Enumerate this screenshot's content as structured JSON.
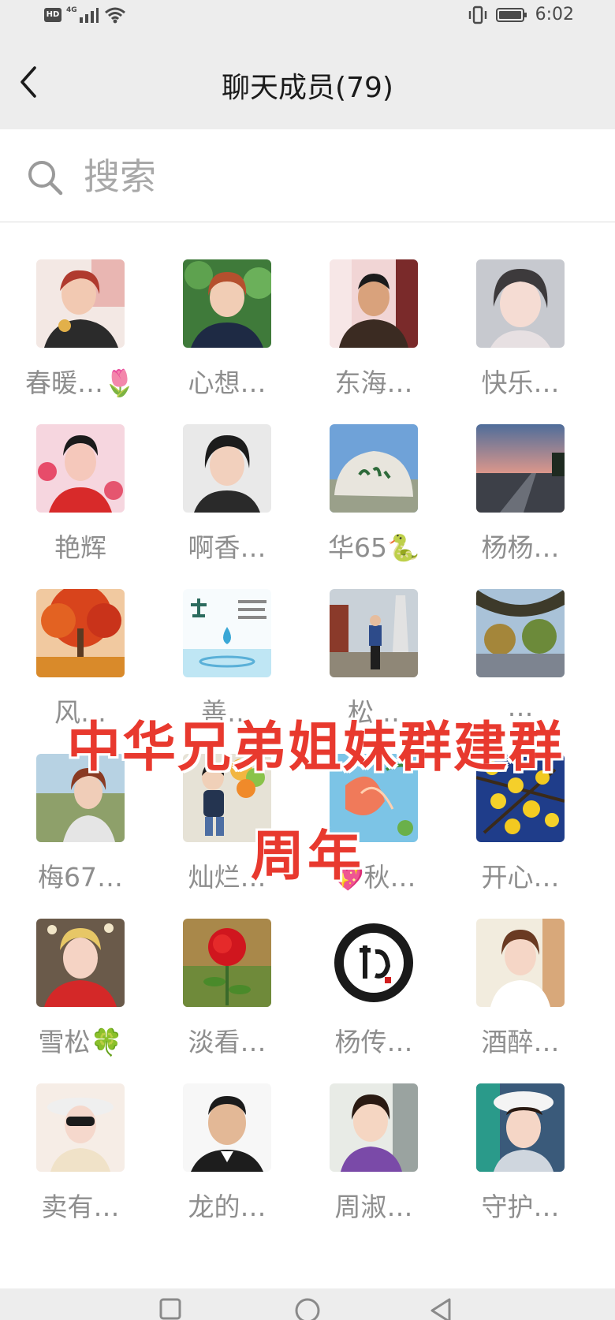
{
  "status_bar": {
    "hd_label": "HD",
    "network_label": "4G",
    "time": "6:02"
  },
  "header": {
    "title": "聊天成员(79)",
    "back_icon": "chevron-left-icon"
  },
  "search": {
    "placeholder": "搜索",
    "value": "",
    "icon": "search-icon"
  },
  "members": [
    {
      "name": "春暖…🌷"
    },
    {
      "name": "心想…"
    },
    {
      "name": "东海…"
    },
    {
      "name": "快乐…"
    },
    {
      "name": "艳辉"
    },
    {
      "name": "啊香…"
    },
    {
      "name": "华65🐍"
    },
    {
      "name": "杨杨…"
    },
    {
      "name": "风…"
    },
    {
      "name": "善…"
    },
    {
      "name": "松…"
    },
    {
      "name": "…"
    },
    {
      "name": "梅67…"
    },
    {
      "name": "灿烂…"
    },
    {
      "name": "💖秋…"
    },
    {
      "name": "开心…"
    },
    {
      "name": "雪松🍀"
    },
    {
      "name": "淡看…"
    },
    {
      "name": "杨传…"
    },
    {
      "name": "酒醉…"
    },
    {
      "name": "卖有…"
    },
    {
      "name": "龙的…"
    },
    {
      "name": "周淑…"
    },
    {
      "name": "守护…"
    }
  ],
  "overlay": {
    "line1": "中华兄弟姐妹群建群",
    "line2": "周年"
  },
  "nav_bar": {
    "icons": [
      "square-icon",
      "circle-icon",
      "triangle-back-icon"
    ]
  },
  "colors": {
    "header_bg": "#ededed",
    "name_text": "#8e8e8e",
    "overlay_text": "#e8392e"
  }
}
